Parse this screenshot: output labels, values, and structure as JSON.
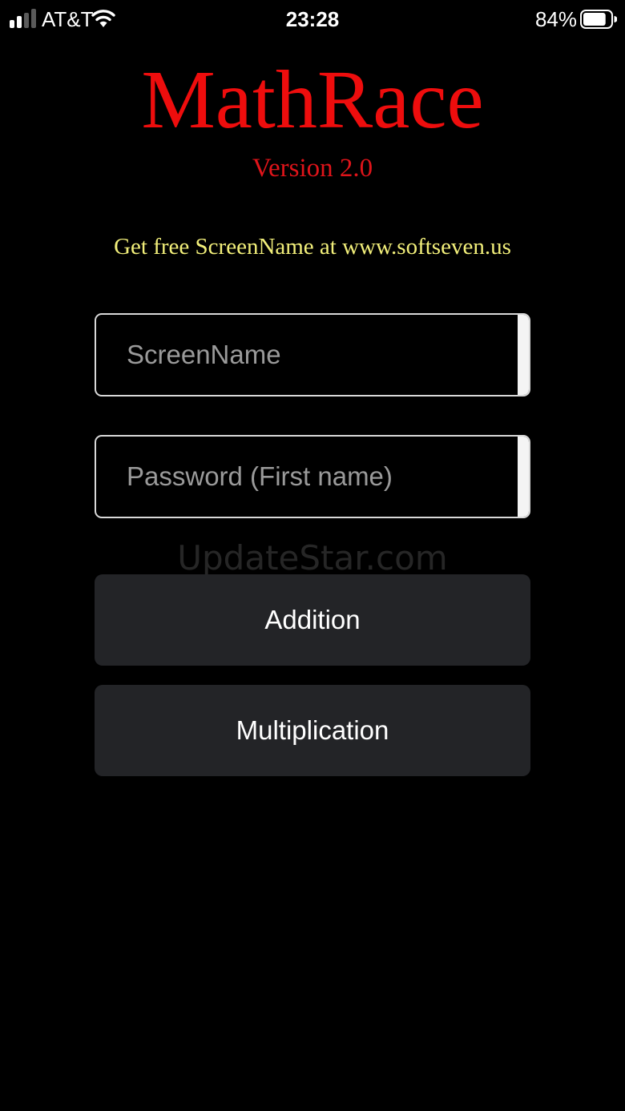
{
  "status_bar": {
    "carrier": "AT&T",
    "time": "23:28",
    "battery_percent": "84%",
    "battery_level": 0.84,
    "signal_bars": 2,
    "signal_bars_total": 4,
    "icons": {
      "signal": "cellular-signal-icon",
      "wifi": "wifi-icon",
      "battery": "battery-icon"
    }
  },
  "header": {
    "title": "MathRace",
    "version": "Version 2.0",
    "promo": "Get free ScreenName at www.softseven.us"
  },
  "login": {
    "screenname": {
      "placeholder": "ScreenName",
      "value": ""
    },
    "password": {
      "placeholder": "Password (First name)",
      "value": ""
    }
  },
  "watermark": "UpdateStar.com",
  "buttons": {
    "addition": "Addition",
    "multiplication": "Multiplication"
  },
  "colors": {
    "background": "#000000",
    "title": "#ee0d0d",
    "version": "#e0141a",
    "promo": "#f2ef7a",
    "button_bg": "#232427",
    "field_border": "#d9d9d9",
    "placeholder": "#9a9a9a"
  }
}
